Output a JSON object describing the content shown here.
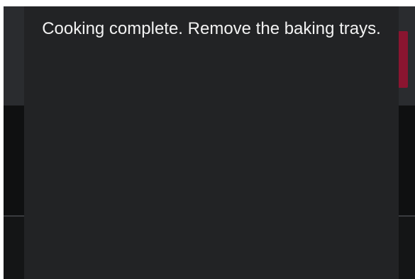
{
  "dialog": {
    "message": "Cooking complete. Remove the baking trays."
  },
  "colors": {
    "background": "#121314",
    "overlay": "#222325",
    "text": "#f2f2f2",
    "accent": "#8a1530"
  }
}
